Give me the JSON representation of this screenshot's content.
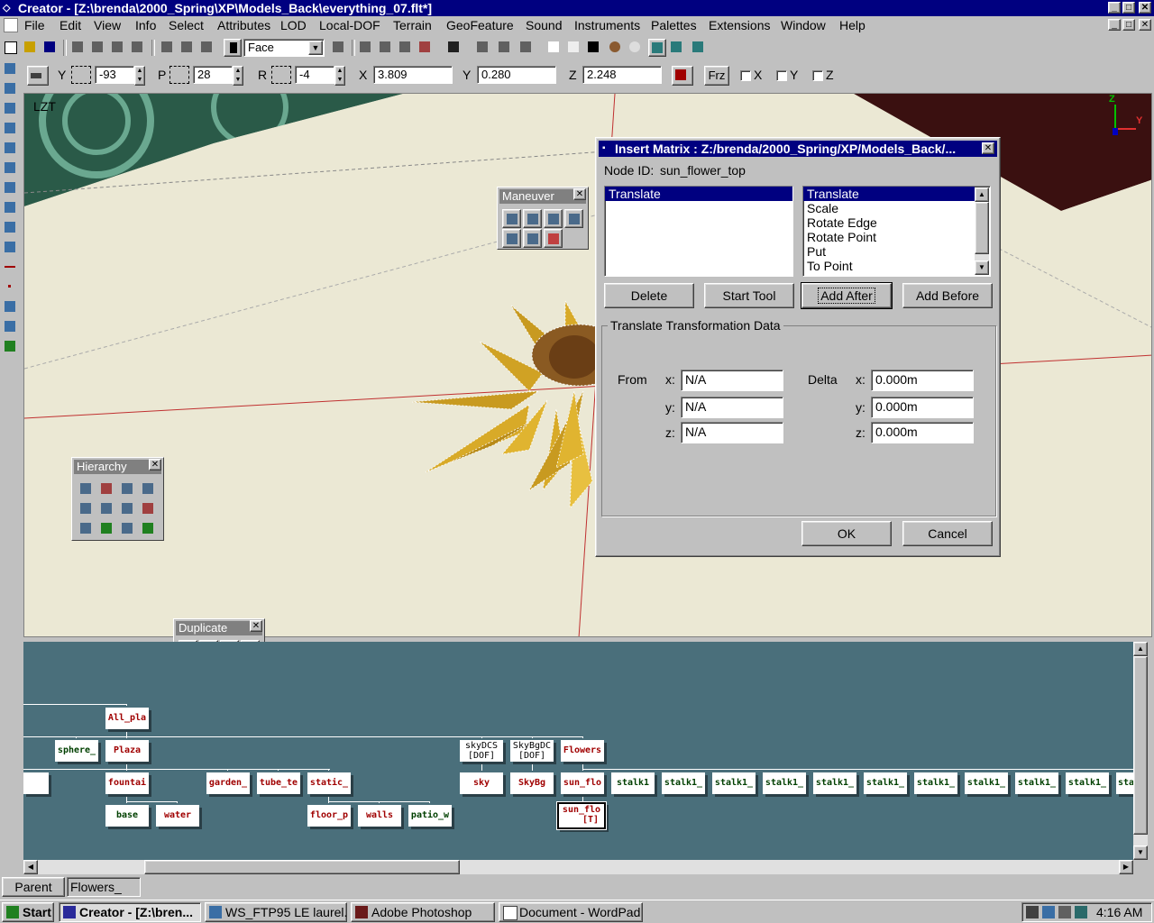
{
  "window": {
    "title": "Creator - [Z:\\brenda\\2000_Spring\\XP\\Models_Back\\everything_07.flt*]"
  },
  "menu": [
    "File",
    "Edit",
    "View",
    "Info",
    "Select",
    "Attributes",
    "LOD",
    "Local-DOF",
    "Terrain",
    "GeoFeature",
    "Sound",
    "Instruments",
    "Palettes",
    "Extensions",
    "Window",
    "Help"
  ],
  "toolbar": {
    "mode_select": "Face"
  },
  "coords": {
    "y_label": "Y",
    "y_value": "-93",
    "p_label": "P",
    "p_value": "28",
    "r_label": "R",
    "r_value": "-4",
    "x_label": "X",
    "x_value": "3.809",
    "y2_label": "Y",
    "y2_value": "0.280",
    "z_label": "Z",
    "z_value": "2.248",
    "frz_label": "Frz",
    "check_x": "X",
    "check_y": "Y",
    "check_z": "Z"
  },
  "viewport": {
    "label": "LZT",
    "axis_z": "Z",
    "axis_y": "Y"
  },
  "palettes": {
    "maneuver": "Maneuver",
    "hierarchy": "Hierarchy",
    "duplicate": "Duplicate"
  },
  "dialog": {
    "title": "Insert Matrix : Z:/brenda/2000_Spring/XP/Models_Back/...",
    "node_id_label": "Node ID:",
    "node_id_value": "sun_flower_top",
    "left_list": [
      "Translate"
    ],
    "right_list": [
      "Translate",
      "Scale",
      "Rotate Edge",
      "Rotate Point",
      "Put",
      "To Point"
    ],
    "buttons": {
      "delete": "Delete",
      "start_tool": "Start Tool",
      "add_after": "Add After",
      "add_before": "Add Before",
      "ok": "OK",
      "cancel": "Cancel"
    },
    "group_title": "Translate Transformation Data",
    "from_label": "From",
    "delta_label": "Delta",
    "x_label": "x:",
    "y_label": "y:",
    "z_label": "z:",
    "from": {
      "x": "N/A",
      "y": "N/A",
      "z": "N/A"
    },
    "delta": {
      "x": "0.000m",
      "y": "0.000m",
      "z": "0.000m"
    }
  },
  "graph": {
    "nodes": {
      "all_pla": "All_pla",
      "sphere": "sphere_",
      "plaza": "Plaza",
      "skydcs_1": "skyDCS",
      "skydcs_2": "[DOF]",
      "skybgdc_1": "SkyBgDC",
      "skybgdc_2": "[DOF]",
      "flowers": "Flowers",
      "fountai": "fountai",
      "garden": "garden_",
      "tube": "tube_te",
      "static": "static_",
      "sky": "sky",
      "skybg": "SkyBg",
      "sun_flo": "sun_flo",
      "stalks": [
        "stalk1",
        "stalk1_",
        "stalk1_",
        "stalk1_",
        "stalk1_",
        "stalk1_",
        "stalk1_",
        "stalk1_",
        "stalk1_",
        "stalk1_"
      ],
      "sta": "sta",
      "base": "base",
      "water": "water",
      "floor": "floor_p",
      "walls": "walls",
      "patio": "patio_w",
      "sun_flo_t1": "sun_flo",
      "sun_flo_t2": "[T]"
    }
  },
  "status_tabs": {
    "parent": "Parent",
    "flowers": "Flowers_"
  },
  "taskbar": {
    "start": "Start",
    "tasks": [
      "Creator - [Z:\\bren...",
      "WS_FTP95 LE laurel...",
      "Adobe Photoshop",
      "Document - WordPad"
    ],
    "clock": "4:16 AM"
  }
}
